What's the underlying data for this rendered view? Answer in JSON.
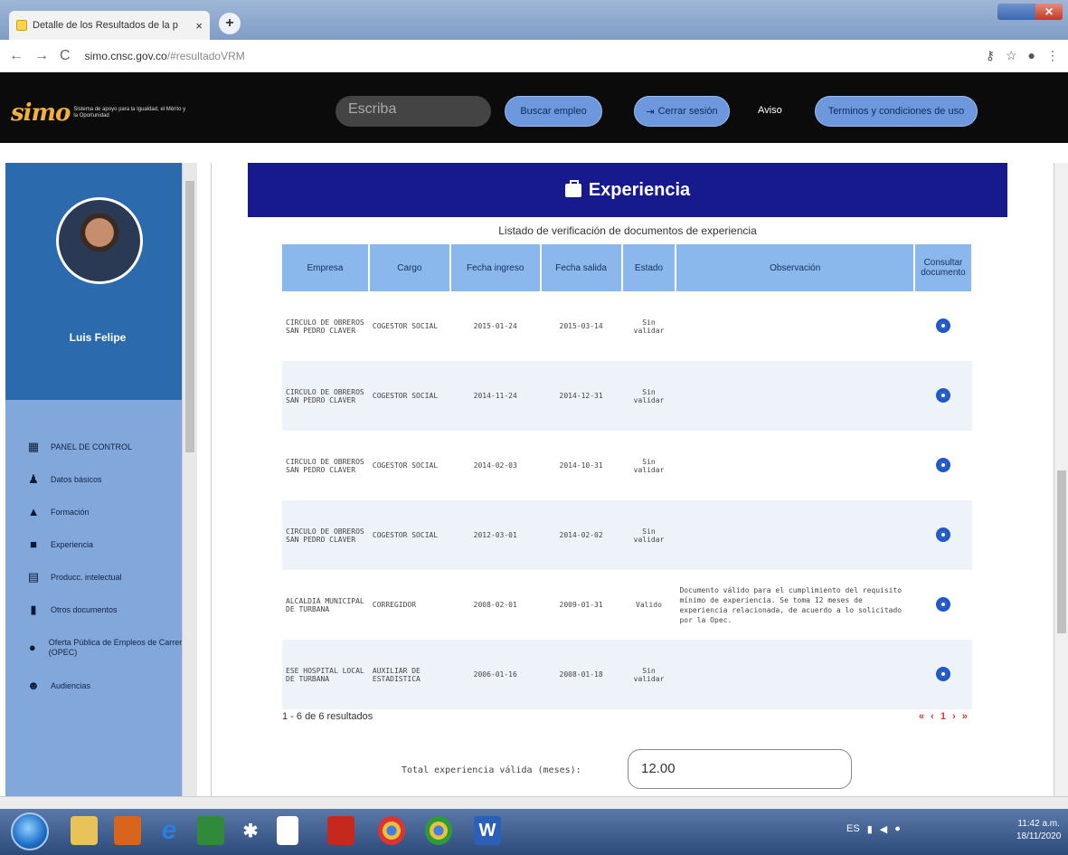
{
  "browser": {
    "tab_title": "Detalle de los Resultados de la p",
    "tab_close": "×",
    "new_tab": "+",
    "url_host": "simo.cnsc.gov.co",
    "url_rest": "/#resultadoVRM",
    "back": "←",
    "forward": "→",
    "reload": "C"
  },
  "header": {
    "logo_mark": "simo",
    "logo_tag": "Sistema de apoyo para la Igualdad, el Mérito y la Oportunidad",
    "search_placeholder": "Escriba",
    "buscar_label": "Buscar empleo",
    "cerrar_label": "Cerrar sesión",
    "aviso_label": "Aviso",
    "terminos_label": "Terminos y condiciones de uso"
  },
  "sidebar": {
    "user_name": "Luis Felipe",
    "items": [
      {
        "label": "PANEL DE CONTROL",
        "icon": "dashboard-icon"
      },
      {
        "label": "Datos básicos",
        "icon": "users-icon"
      },
      {
        "label": "Formación",
        "icon": "graduation-icon"
      },
      {
        "label": "Experiencia",
        "icon": "briefcase-icon"
      },
      {
        "label": "Producc. intelectual",
        "icon": "book-icon"
      },
      {
        "label": "Otros documentos",
        "icon": "document-icon"
      },
      {
        "label": "Oferta Pública de Empleos de Carrera (OPEC)",
        "icon": "globe-icon"
      },
      {
        "label": "Audiencias",
        "icon": "audience-icon"
      }
    ]
  },
  "main": {
    "title": "Experiencia",
    "caption": "Listado de verificación de documentos de experiencia",
    "columns": [
      "Empresa",
      "Cargo",
      "Fecha ingreso",
      "Fecha salida",
      "Estado",
      "Observación",
      "Consultar documento"
    ],
    "rows": [
      {
        "empresa": "CIRCULO DE OBREROS SAN PEDRO CLAVER",
        "cargo": "COGESTOR SOCIAL",
        "ingreso": "2015-01-24",
        "salida": "2015-03-14",
        "estado": "Sin validar",
        "obs": ""
      },
      {
        "empresa": "CIRCULO DE OBREROS SAN PEDRO CLAVER",
        "cargo": "COGESTOR SOCIAL",
        "ingreso": "2014-11-24",
        "salida": "2014-12-31",
        "estado": "Sin validar",
        "obs": ""
      },
      {
        "empresa": "CIRCULO DE OBREROS SAN PEDRO CLAVER",
        "cargo": "COGESTOR SOCIAL",
        "ingreso": "2014-02-03",
        "salida": "2014-10-31",
        "estado": "Sin validar",
        "obs": ""
      },
      {
        "empresa": "CIRCULO DE OBREROS SAN PEDRO CLAVER",
        "cargo": "COGESTOR SOCIAL",
        "ingreso": "2012-03-01",
        "salida": "2014-02-02",
        "estado": "Sin validar",
        "obs": ""
      },
      {
        "empresa": "ALCALDIA MUNICIPAL DE TURBANA",
        "cargo": "CORREGIDOR",
        "ingreso": "2008-02-01",
        "salida": "2009-01-31",
        "estado": "Valido",
        "obs": "Documento válido para el cumplimiento del requisito mínimo de experiencia. Se toma 12 meses de experiencia relacionada, de acuerdo a lo solicitado por la Opec."
      },
      {
        "empresa": "ESE HOSPITAL LOCAL DE TURBANA",
        "cargo": "AUXILIAR DE ESTADISTICA",
        "ingreso": "2006-01-16",
        "salida": "2008-01-18",
        "estado": "Sin validar",
        "obs": ""
      }
    ],
    "results_text": "1 - 6 de 6 resultados",
    "pager": "« ‹ 1 › »",
    "total_label": "Total experiencia válida (meses):",
    "total_value": "12.00"
  },
  "taskbar": {
    "lang": "ES",
    "time": "11:42 a.m.",
    "date": "18/11/2020"
  }
}
